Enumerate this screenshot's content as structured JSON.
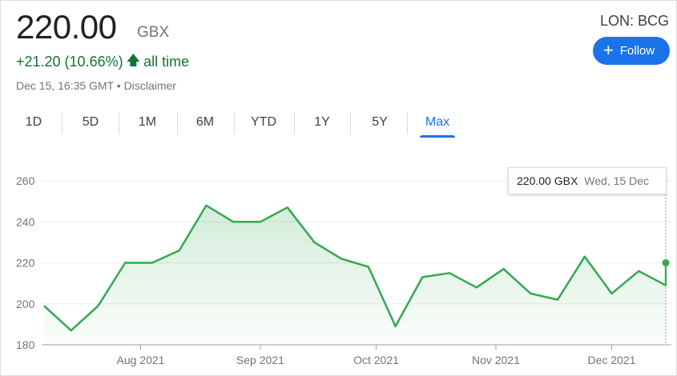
{
  "quote": {
    "price": "220.00",
    "currency": "GBX",
    "change": "+21.20 (10.66%)",
    "change_period": "all time",
    "timestamp": "Dec 15, 16:35 GMT",
    "separator": " • ",
    "disclaimer": "Disclaimer",
    "ticker": "LON: BCG"
  },
  "follow_button": {
    "label": "Follow",
    "icon": "plus-icon",
    "color": "#1a73e8"
  },
  "tabs": [
    {
      "label": "1D",
      "active": false
    },
    {
      "label": "5D",
      "active": false
    },
    {
      "label": "1M",
      "active": false
    },
    {
      "label": "6M",
      "active": false
    },
    {
      "label": "YTD",
      "active": false
    },
    {
      "label": "1Y",
      "active": false
    },
    {
      "label": "5Y",
      "active": false
    },
    {
      "label": "Max",
      "active": true
    }
  ],
  "tooltip": {
    "price": "220.00 GBX",
    "date": "Wed, 15 Dec"
  },
  "colors": {
    "positive": "#137333",
    "line": "#34a853",
    "accent": "#1a73e8"
  },
  "chart_data": {
    "type": "area",
    "title": "",
    "xlabel": "",
    "ylabel": "",
    "ylim": [
      180,
      260
    ],
    "yticks": [
      180,
      200,
      220,
      240,
      260
    ],
    "xtick_labels": [
      "Aug 2021",
      "Sep 2021",
      "Oct 2021",
      "Nov 2021",
      "Dec 2021"
    ],
    "grid": true,
    "legend": "none",
    "series": [
      {
        "x": [
          "2021-07-07",
          "2021-07-14",
          "2021-07-21",
          "2021-07-28",
          "2021-08-04",
          "2021-08-11",
          "2021-08-18",
          "2021-08-25",
          "2021-09-01",
          "2021-09-08",
          "2021-09-15",
          "2021-09-22",
          "2021-09-29",
          "2021-10-06",
          "2021-10-13",
          "2021-10-20",
          "2021-10-27",
          "2021-11-03",
          "2021-11-10",
          "2021-11-17",
          "2021-11-24",
          "2021-12-01",
          "2021-12-08",
          "2021-12-15"
        ],
        "values": [
          199,
          187,
          199,
          220,
          220,
          226,
          248,
          240,
          240,
          247,
          230,
          222,
          218,
          189,
          213,
          215,
          208,
          217,
          205,
          202,
          223,
          205,
          216,
          209
        ]
      }
    ],
    "last_point": {
      "x": "2021-12-15",
      "value": 220
    }
  }
}
